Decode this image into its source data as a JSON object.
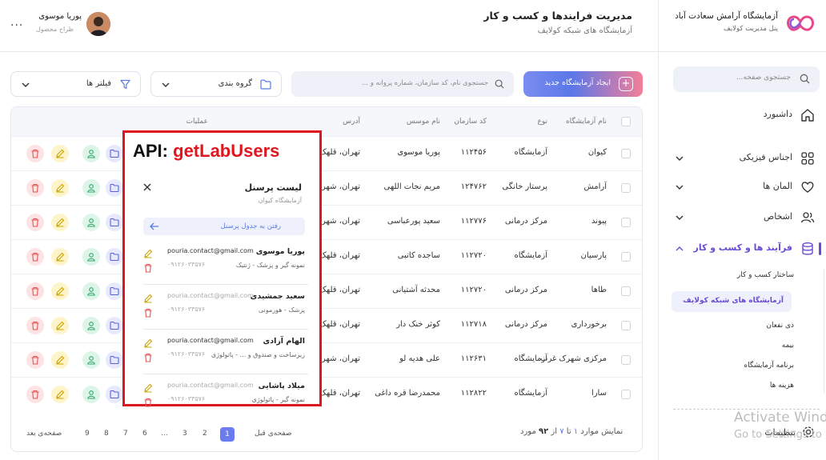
{
  "sidebar": {
    "brand_title": "آزمایشگاه آرامش سعادت آباد",
    "brand_subtitle": "پنل مدیریت کولایف",
    "search_placeholder": "جستجوی صفحه...",
    "items": [
      {
        "label": "داشبورد",
        "icon": "home-icon"
      },
      {
        "label": "اجناس فیزیکی",
        "icon": "grid-icon"
      },
      {
        "label": "المان ها",
        "icon": "heart-icon"
      },
      {
        "label": "اشخاص",
        "icon": "users-icon"
      },
      {
        "label": "فرآیند ها و کسب و کار",
        "icon": "database-icon"
      }
    ],
    "sub_items": [
      "ساختار کسب و کار",
      "آزمایشگاه های شبکه کولایف",
      "ذی نفعان",
      "بیمه",
      "برنامه آزمایشگاه",
      "هزینه ها"
    ],
    "settings_label": "تنظیمات"
  },
  "watermark": {
    "line1": "Activate Wind",
    "line2": "Go to Settings to"
  },
  "header": {
    "title": "مدیریت فرایندها و کسب و کار",
    "subtitle": "آزمایشگاه های شبکه کولایف",
    "user_name": "پوریا موسوی",
    "user_role": "طراح محصول",
    "more": "..."
  },
  "toolbar": {
    "create_label": "ایجاد آزمایشگاه جدید",
    "search_placeholder": "جستجوی نام، کد سازمان، شماره پروانه و ...",
    "group_label": "گروه بندی",
    "filter_label": "فیلتر ها"
  },
  "table": {
    "headers": {
      "name": "نام آزمایشگاه",
      "type": "نوع",
      "code": "کد سازمان",
      "founder": "نام موسس",
      "address": "آدرس",
      "actions": "عملیات"
    },
    "rows": [
      {
        "name": "کیوان",
        "type": "آزمایشگاه",
        "code": "۱۱۲۴۵۶",
        "founder": "پوریا موسوی",
        "address": "تهران، قلهک، خیابان"
      },
      {
        "name": "آرامش",
        "type": "پرستار خانگی",
        "code": "۱۲۴۷۶۲",
        "founder": "مریم نجات اللهی",
        "address": "تهران، شهرک"
      },
      {
        "name": "پیوند",
        "type": "مرکز درمانی",
        "code": "۱۱۲۷۷۶",
        "founder": "سعید پورعباسی",
        "address": "تهران، شهرک"
      },
      {
        "name": "پارسیان",
        "type": "آزمایشگاه",
        "code": "۱۱۲۷۲۰",
        "founder": "ساجده کاتبی",
        "address": "تهران، قلهک"
      },
      {
        "name": "طاها",
        "type": "مرکز درمانی",
        "code": "۱۱۲۷۲۰",
        "founder": "محدثه آشتیانی",
        "address": "تهران، قلهک"
      },
      {
        "name": "برخورداری",
        "type": "مرکز درمانی",
        "code": "۱۱۲۷۱۸",
        "founder": "کوثر خنک دار",
        "address": "تهران، قلهک"
      },
      {
        "name": "مرکزی شهرک غرب",
        "type": "آزمایشگاه",
        "code": "۱۱۲۶۳۱",
        "founder": "علی هدیه لو",
        "address": "تهران، شهرک"
      },
      {
        "name": "سارا",
        "type": "آزمایشگاه",
        "code": "۱۱۲۸۲۲",
        "founder": "محمدرضا قره داغی",
        "address": "تهران، قلهک"
      }
    ]
  },
  "pagination": {
    "info_prefix": "نمایش موارد",
    "from": "۱",
    "to_word": "تا",
    "to": "۷",
    "of_word": "از",
    "total": "۹۲",
    "items_word": "مورد",
    "prev": "صفحه‌ی قبل",
    "next": "صفحه‌ی بعد",
    "pages": [
      "1",
      "2",
      "3",
      "...",
      "6",
      "7",
      "8",
      "9"
    ]
  },
  "overlay": {
    "api_prefix": "API:",
    "api_name": "getLabUsers",
    "title": "لیست پرسنل",
    "subtitle": "آزمایشگاه کیوان",
    "link_label": "رفتن به جدول پرسنل",
    "people": [
      {
        "name": "پوریا موسوی",
        "role": "نمونه گیر و پزشک - ژنتیک",
        "email": "pouria.contact@gmail.com",
        "phone": "۰۹۱۲۶۰۳۳۵۷۶"
      },
      {
        "name": "سعید جمشیدی",
        "role": "پزشک - هورمونی",
        "email": "pouria.contact@gmail.com",
        "phone": "۰۹۱۲۶۰۳۳۵۷۶"
      },
      {
        "name": "الهام آزادی",
        "role": "زیرساخت و صندوق و ... - پاتولوژی",
        "email": "pouria.contact@gmail.com",
        "phone": "۰۹۱۲۶۰۳۳۵۷۶"
      },
      {
        "name": "میلاد پاشایی",
        "role": "نمونه گیر - پاتولوژی",
        "email": "pouria.contact@gmail.com",
        "phone": "۰۹۱۲۶۰۳۳۵۷۶"
      }
    ]
  },
  "colors": {
    "accent": "#6b4bd6",
    "primary": "#5a78e8",
    "api_red": "#e0161f"
  }
}
